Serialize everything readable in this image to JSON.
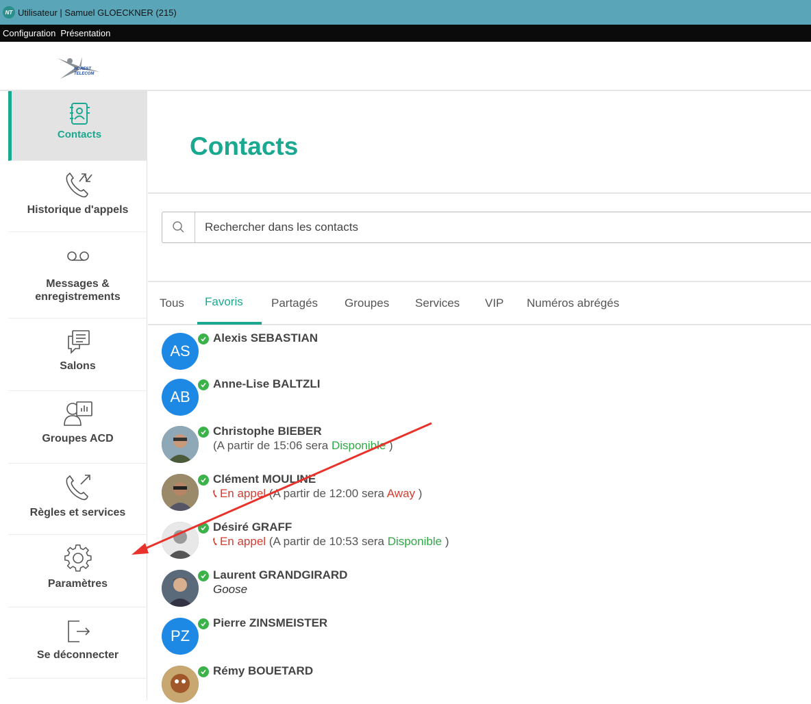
{
  "window": {
    "title": "Utilisateur | Samuel GLOECKNER (215)",
    "app_icon_text": "NT"
  },
  "menu": {
    "items": [
      "Configuration",
      "Présentation"
    ]
  },
  "logo": {
    "line1": "NOREST",
    "line2": "TELECOM"
  },
  "sidebar": {
    "items": [
      {
        "label": "Contacts",
        "icon": "contacts-book-icon",
        "active": true
      },
      {
        "label": "Historique d'appels",
        "icon": "call-history-icon",
        "active": false
      },
      {
        "label": "Messages & enregistrements",
        "icon": "voicemail-icon",
        "active": false
      },
      {
        "label": "Salons",
        "icon": "chat-rooms-icon",
        "active": false
      },
      {
        "label": "Groupes ACD",
        "icon": "acd-group-icon",
        "active": false
      },
      {
        "label": "Règles et services",
        "icon": "call-forward-icon",
        "active": false
      },
      {
        "label": "Paramètres",
        "icon": "gear-icon",
        "active": false
      },
      {
        "label": "Se déconnecter",
        "icon": "logout-icon",
        "active": false
      }
    ]
  },
  "main": {
    "title": "Contacts",
    "search": {
      "placeholder": "Rechercher dans les contacts",
      "value": ""
    },
    "tabs": [
      {
        "label": "Tous",
        "active": false
      },
      {
        "label": "Favoris",
        "active": true
      },
      {
        "label": "Partagés",
        "active": false
      },
      {
        "label": "Groupes",
        "active": false
      },
      {
        "label": "Services",
        "active": false
      },
      {
        "label": "VIP",
        "active": false
      },
      {
        "label": "Numéros abrégés",
        "active": false
      }
    ],
    "contacts": [
      {
        "name": "Alexis SEBASTIAN",
        "initials": "AS"
      },
      {
        "name": "Anne-Lise BALTZLI",
        "initials": "AB"
      },
      {
        "name": "Christophe BIEBER",
        "sub_prefix": "(A partir de 15:06 sera ",
        "sub_status": "Disponible",
        "sub_suffix": " )"
      },
      {
        "name": "Clément MOULINE",
        "call_status": "En appel",
        "sub_prefix": " (A partir de 12:00 sera ",
        "sub_status": "Away",
        "sub_suffix": " )"
      },
      {
        "name": "Désiré GRAFF",
        "call_status": "En appel",
        "sub_prefix": " (A partir de 10:53 sera ",
        "sub_status": "Disponible",
        "sub_suffix": " )"
      },
      {
        "name": "Laurent GRANDGIRARD",
        "note": "Goose"
      },
      {
        "name": "Pierre ZINSMEISTER",
        "initials": "PZ"
      },
      {
        "name": "Rémy BOUETARD"
      }
    ]
  },
  "colors": {
    "accent": "#1aa890",
    "titlebar": "#5aa6b8",
    "menubar": "#0b0b0b",
    "avatar_blue": "#1e88e5",
    "presence_green": "#3bb24a",
    "status_green": "#2fa845",
    "status_red": "#d63b2f",
    "annotation_arrow": "#e8322b"
  }
}
